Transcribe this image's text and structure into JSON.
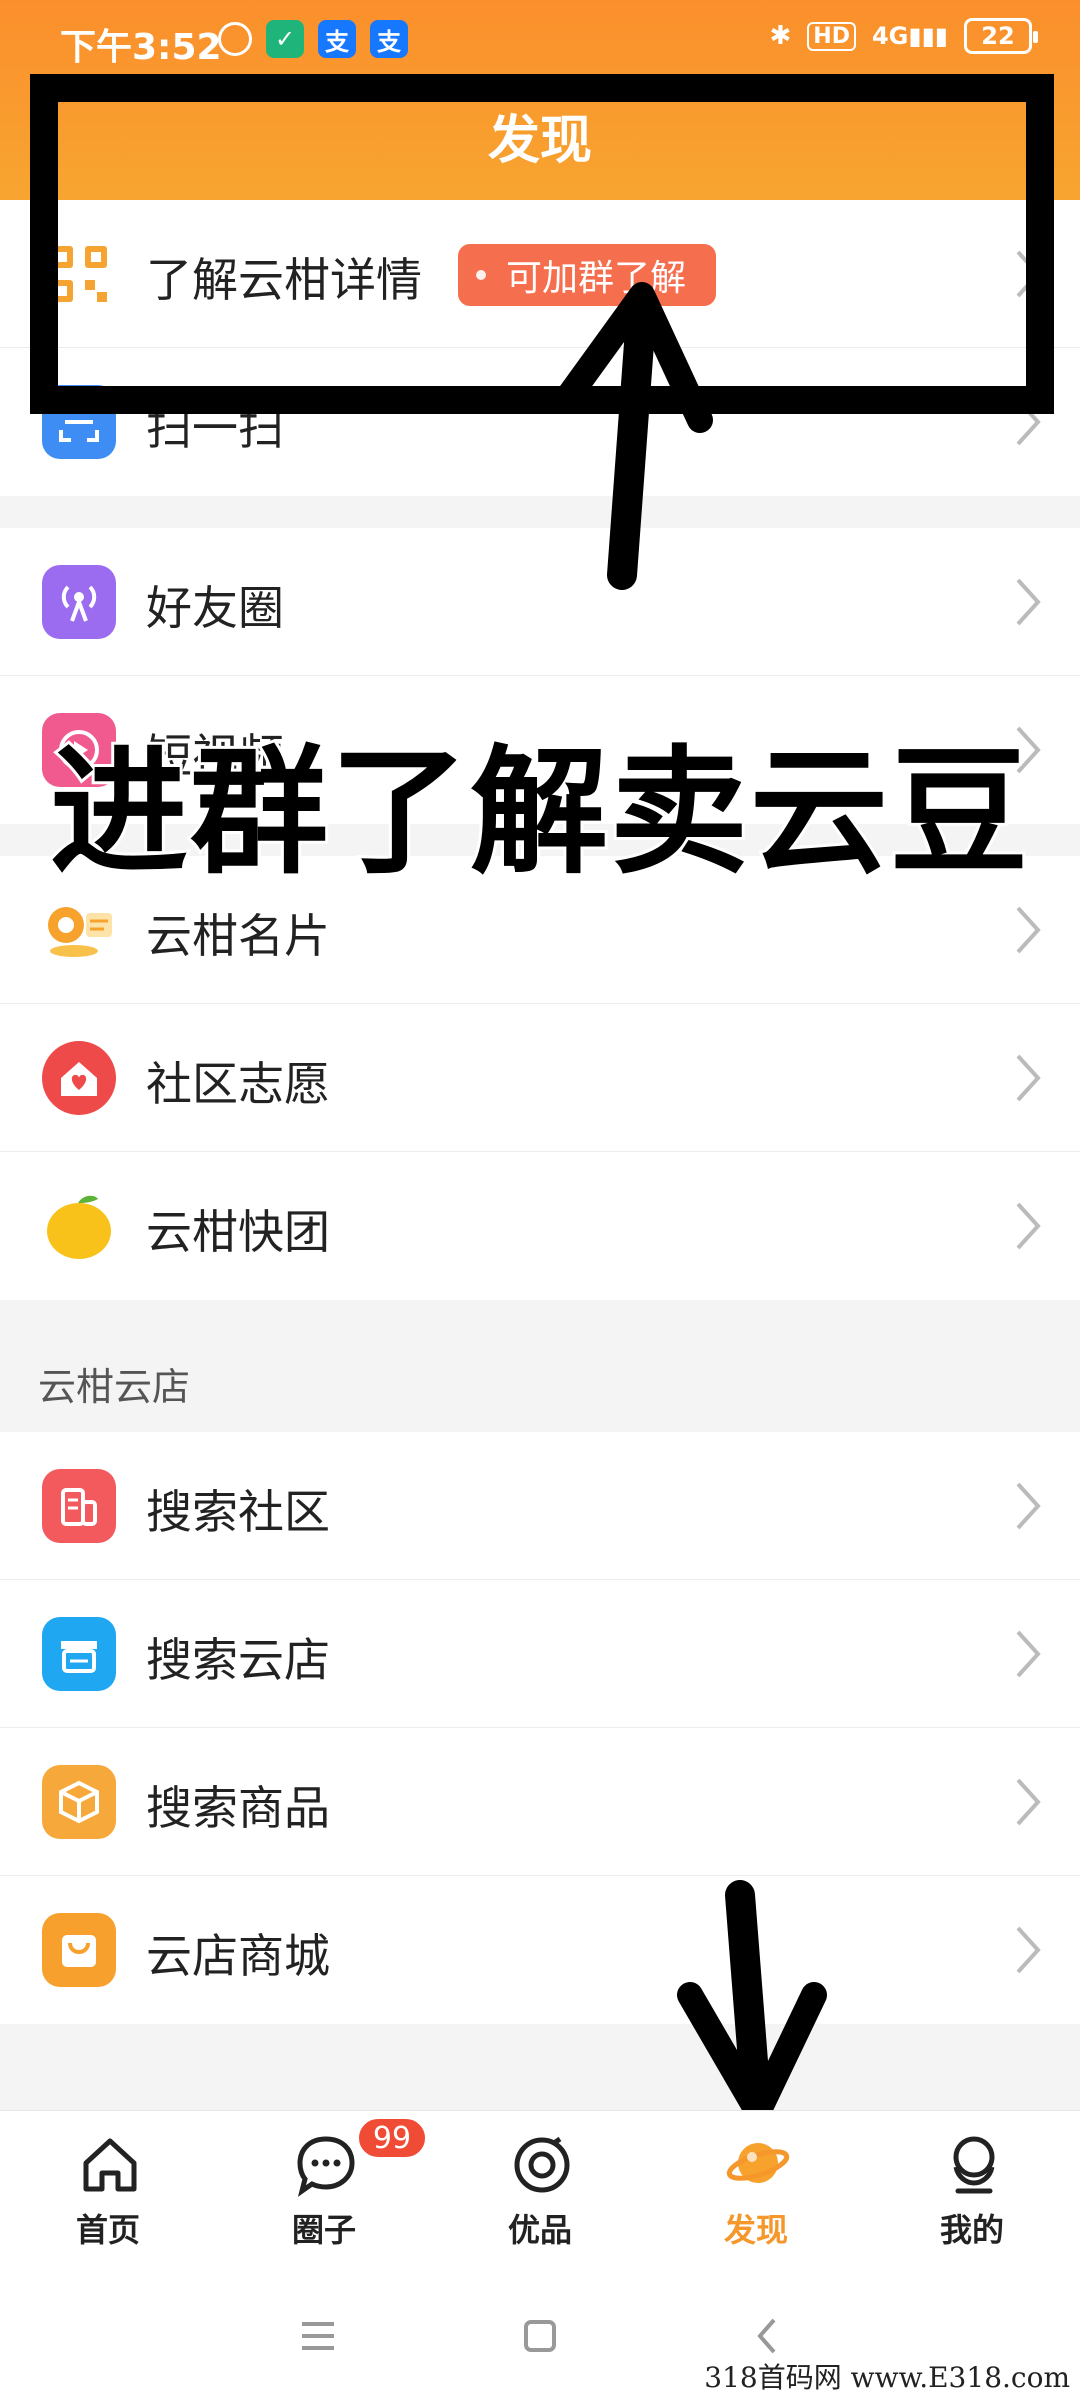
{
  "status_bar": {
    "time": "下午3:52",
    "pay_icon_text": "支",
    "hd": "HD",
    "network": "4G",
    "battery": "22"
  },
  "header": {
    "title": "发现"
  },
  "groups": [
    {
      "items": [
        {
          "label": "了解云柑详情",
          "icon": "qr-code-icon",
          "tag": "可加群了解"
        },
        {
          "label": "扫一扫",
          "icon": "scan-icon"
        }
      ]
    },
    {
      "items": [
        {
          "label": "好友圈",
          "icon": "broadcast-icon"
        },
        {
          "label": "短视频",
          "icon": "play-icon"
        }
      ]
    },
    {
      "items": [
        {
          "label": "云柑名片",
          "icon": "business-card-icon"
        },
        {
          "label": "社区志愿",
          "icon": "heart-house-icon"
        },
        {
          "label": "云柑快团",
          "icon": "orange-icon"
        }
      ]
    }
  ],
  "section": {
    "label": "云柑云店"
  },
  "store_items": [
    {
      "label": "搜索社区",
      "icon": "building-icon"
    },
    {
      "label": "搜索云店",
      "icon": "storefront-icon"
    },
    {
      "label": "搜索商品",
      "icon": "box-icon"
    },
    {
      "label": "云店商城",
      "icon": "shopping-bag-icon"
    }
  ],
  "overlay": {
    "caption": "进群了解卖云豆"
  },
  "tabbar": {
    "tabs": [
      {
        "label": "首页",
        "icon": "home-icon"
      },
      {
        "label": "圈子",
        "icon": "chat-bubble-icon"
      },
      {
        "label": "优品",
        "icon": "ring-icon"
      },
      {
        "label": "发现",
        "icon": "planet-icon",
        "active": true
      },
      {
        "label": "我的",
        "icon": "profile-icon"
      }
    ],
    "badge_count": "99"
  },
  "watermark": "318首码网 www.E318.com",
  "colors": {
    "accent": "#f5972b",
    "tag": "#f56e4e",
    "badge": "#f04b34"
  }
}
